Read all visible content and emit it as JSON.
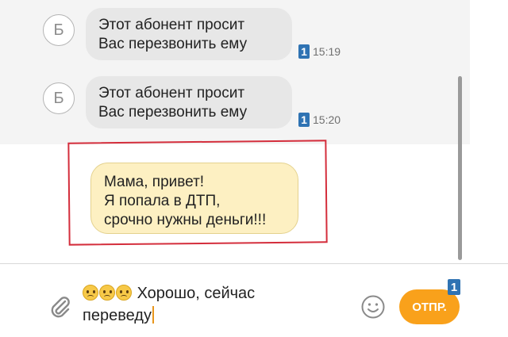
{
  "messages": [
    {
      "avatar_letter": "Б",
      "lines": [
        "Этот абонент  просит",
        "Вас перезвонить ему"
      ],
      "sim": "1",
      "time": "15:19"
    },
    {
      "avatar_letter": "Б",
      "lines": [
        "Этот абонент  просит",
        "Вас перезвонить ему"
      ],
      "sim": "1",
      "time": "15:20"
    }
  ],
  "outgoing": {
    "lines": [
      "Мама, привет!",
      "Я попала в ДТП,",
      "срочно нужны деньги!!!"
    ]
  },
  "composer": {
    "emoji": [
      "worried-face",
      "worried-face",
      "worried-face"
    ],
    "text_line1": "Хорошо, сейчас",
    "text_line2": "переведу",
    "send_label": "ОТПР.",
    "send_sim": "1"
  },
  "colors": {
    "accent": "#f9a11b",
    "sim": "#2f73b3",
    "highlight_frame": "#d42e3c",
    "outgoing_bubble": "#fdf0c2",
    "incoming_bubble": "#e7e7e7"
  }
}
